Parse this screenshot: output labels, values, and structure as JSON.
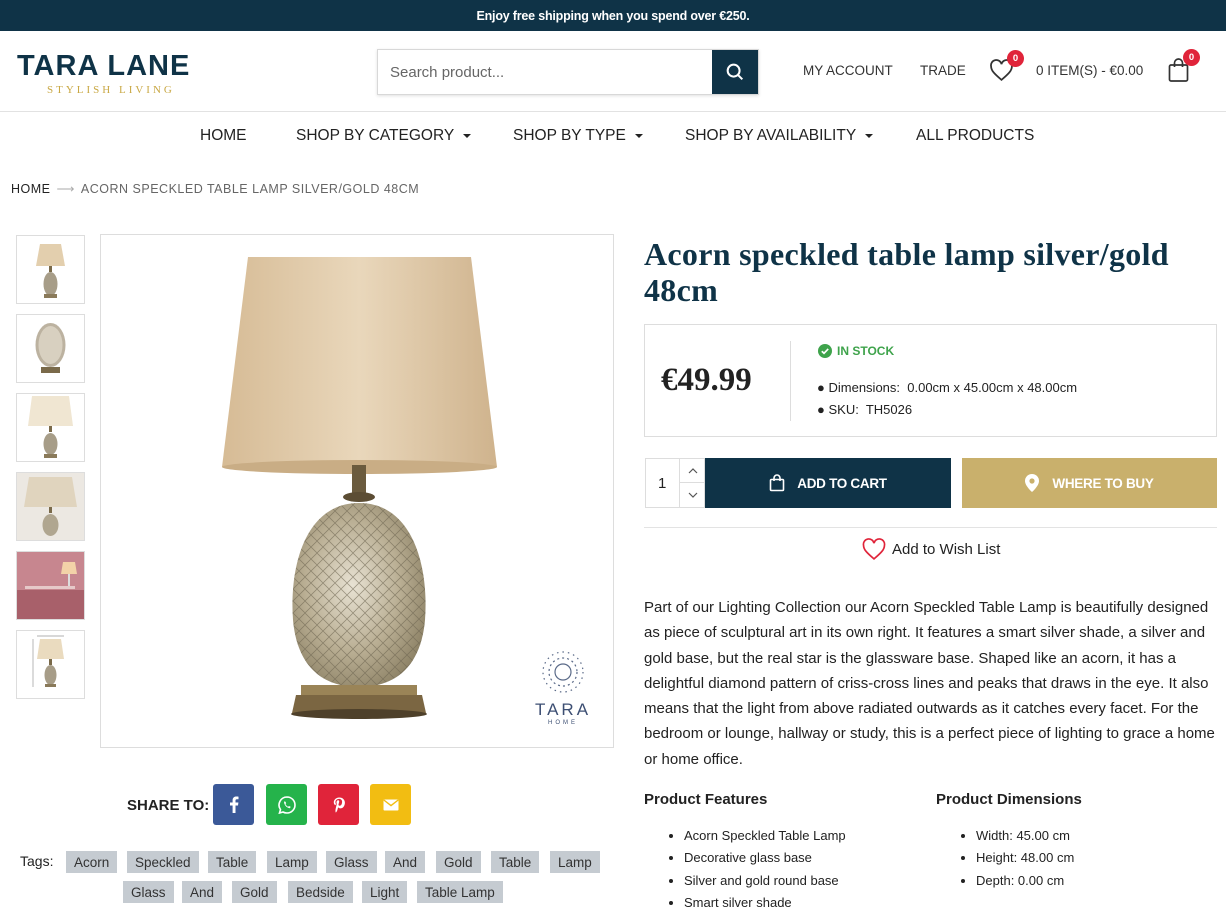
{
  "topbar": {
    "text": "Enjoy free shipping when you spend over €250."
  },
  "header": {
    "logo_main": "TARA LANE",
    "logo_sub": "STYLISH LIVING",
    "search_placeholder": "Search product...",
    "my_account": "MY ACCOUNT",
    "trade": "TRADE",
    "wishlist_count": "0",
    "cart_summary": "0 ITEM(S) - €0.00",
    "cart_count": "0"
  },
  "nav": {
    "items": [
      {
        "label": "HOME"
      },
      {
        "label": "SHOP BY CATEGORY"
      },
      {
        "label": "SHOP BY TYPE"
      },
      {
        "label": "SHOP BY AVAILABILITY"
      },
      {
        "label": "ALL PRODUCTS"
      }
    ]
  },
  "breadcrumb": {
    "home": "HOME",
    "current": "ACORN SPECKLED TABLE LAMP SILVER/GOLD 48CM"
  },
  "gallery": {
    "watermark_brand": "TARA",
    "watermark_sub": "HOME"
  },
  "product": {
    "title": "Acorn speckled table lamp silver/gold 48cm",
    "price": "€49.99",
    "stock": "IN STOCK",
    "dimensions_label": "Dimensions:",
    "dimensions_value": "0.00cm x 45.00cm x 48.00cm",
    "sku_label": "SKU:",
    "sku_value": "TH5026",
    "quantity": "1",
    "add_to_cart": "ADD TO CART",
    "where_to_buy": "WHERE TO BUY",
    "wishlist": "Add to Wish List",
    "description": "Part of our Lighting Collection our Acorn Speckled Table Lamp is beautifully designed as piece of sculptural art in its own right. It features a smart silver shade, a silver and gold base, but the real star is the glassware base. Shaped like an acorn, it has a delightful diamond pattern of criss-cross lines and peaks that draws in the eye. It also means that the light from above radiated outwards as it catches every facet. For the bedroom or lounge, hallway or study, this is a perfect piece of lighting to grace a home or home office.",
    "features_heading": "Product Features",
    "features": [
      "Acorn Speckled Table Lamp",
      "Decorative glass base",
      "Silver and gold round base",
      "Smart silver shade"
    ],
    "dimensions_heading": "Product Dimensions",
    "dimensions_list": [
      "Width: 45.00 cm",
      "Height: 48.00 cm",
      "Depth: 0.00 cm"
    ]
  },
  "share": {
    "label": "SHARE TO:"
  },
  "tags": {
    "label": "Tags:",
    "items": [
      "Acorn",
      "Speckled",
      "Table",
      "Lamp",
      "Glass",
      "And",
      "Gold",
      "Table",
      "Lamp",
      "Glass",
      "And",
      "Gold",
      "Bedside",
      "Light",
      "Table Lamp"
    ]
  },
  "colors": {
    "navy": "#0f3347",
    "gold": "#c9b06c",
    "badge": "#e0243a",
    "stock_green": "#3ea34b",
    "tag_bg": "#c5cbd1"
  }
}
